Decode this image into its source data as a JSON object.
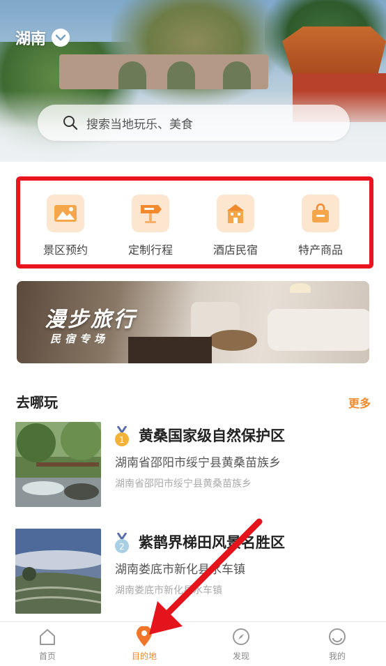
{
  "header": {
    "location": "湖南",
    "search_placeholder": "搜索当地玩乐、美食"
  },
  "categories": [
    {
      "label": "景区预约",
      "icon": "mountain-ticket-icon"
    },
    {
      "label": "定制行程",
      "icon": "signpost-icon"
    },
    {
      "label": "酒店民宿",
      "icon": "hotel-building-icon"
    },
    {
      "label": "特产商品",
      "icon": "shopping-bag-icon"
    }
  ],
  "banner": {
    "title": "漫步旅行",
    "subtitle": "民宿专场"
  },
  "section": {
    "title": "去哪玩",
    "more": "更多"
  },
  "places": [
    {
      "rank": "1",
      "name": "黄桑国家级自然保护区",
      "address": "湖南省邵阳市绥宁县黄桑苗族乡",
      "sub_address": "湖南省邵阳市绥宁县黄桑苗族乡"
    },
    {
      "rank": "2",
      "name": "紫鹊界梯田风景名胜区",
      "address": "湖南娄底市新化县水车镇",
      "sub_address": "湖南娄底市新化县水车镇"
    }
  ],
  "nav": [
    {
      "label": "首页",
      "icon": "home-icon",
      "active": false
    },
    {
      "label": "目的地",
      "icon": "location-pin-icon",
      "active": true
    },
    {
      "label": "发现",
      "icon": "compass-icon",
      "active": false
    },
    {
      "label": "我的",
      "icon": "profile-icon",
      "active": false
    }
  ],
  "colors": {
    "accent": "#f08a2c",
    "highlight_border": "#e8141e",
    "annotation_arrow": "#e3141c"
  }
}
